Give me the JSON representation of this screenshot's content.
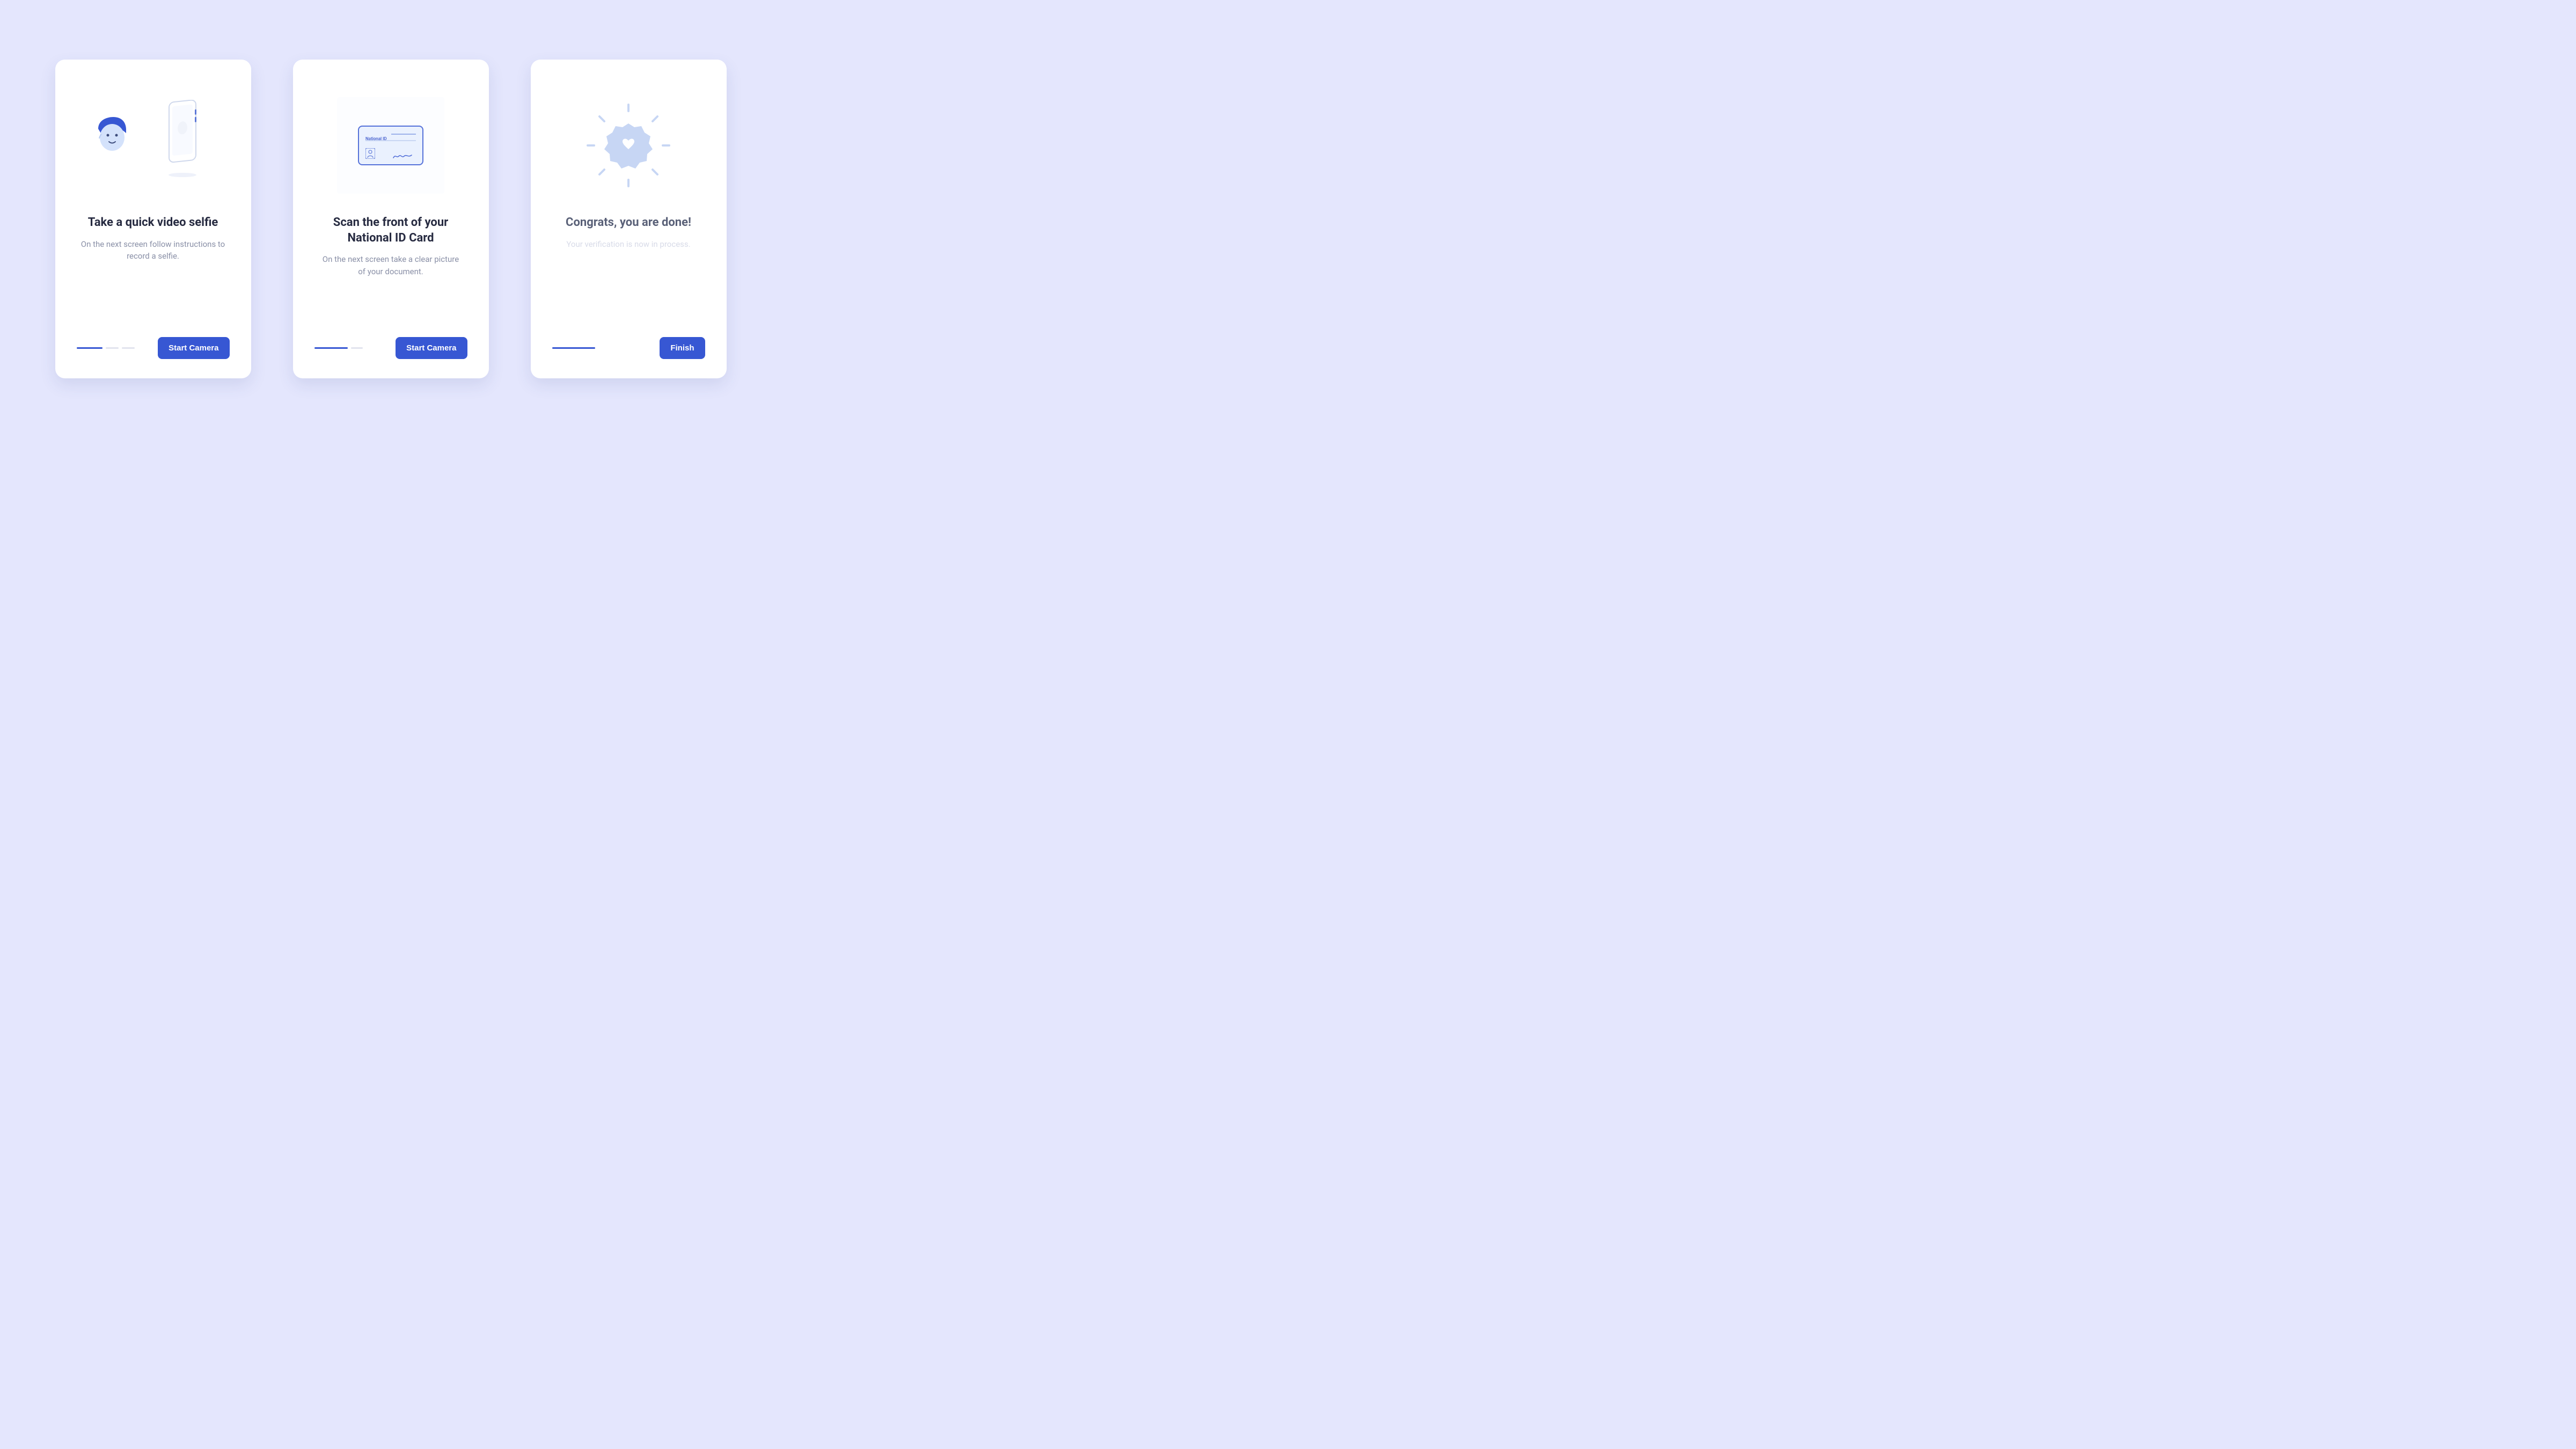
{
  "cards": [
    {
      "title": "Take a quick video selfie",
      "subtitle": "On the next screen follow instructions to record a selfie.",
      "button_label": "Start Camera"
    },
    {
      "title": "Scan the front of your National ID Card",
      "subtitle": "On the next screen take a clear picture of your document.",
      "button_label": "Start Camera",
      "id_label": "National ID"
    },
    {
      "title": "Congrats, you are done!",
      "subtitle": "Your verification is now in process.",
      "button_label": "Finish"
    }
  ],
  "colors": {
    "primary": "#3757d3",
    "text": "#272b41",
    "muted": "#8a90a7",
    "bg": "#e4e6fd"
  }
}
